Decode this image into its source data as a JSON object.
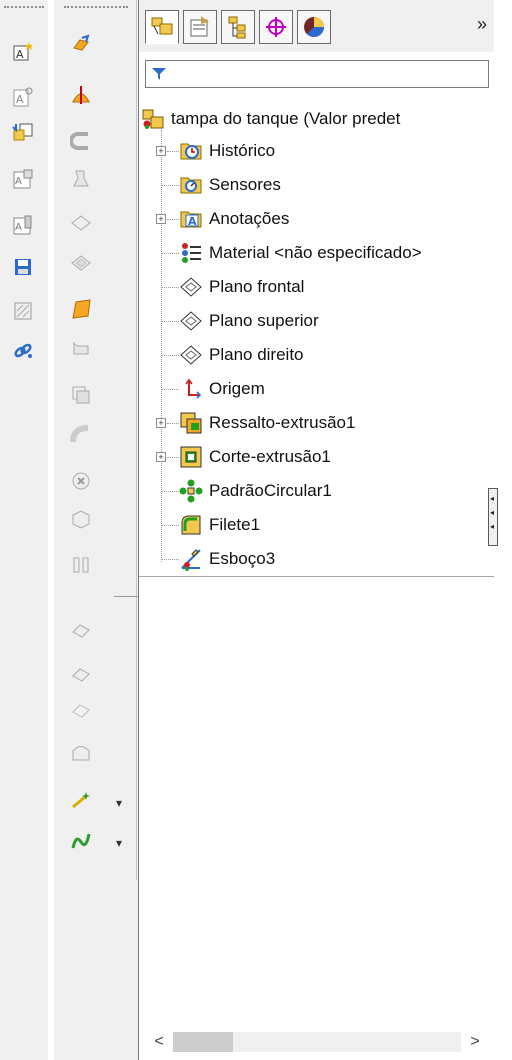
{
  "toolbar_left": {
    "icons": [
      "note-icon",
      "balloon-icon",
      "import-icon",
      "table-icon",
      "block-icon",
      "save-icon",
      "hatch-icon",
      "link-icon"
    ]
  },
  "toolbar_features": {
    "icons": [
      "extrude-boss-icon",
      "revolve-icon",
      "swept-icon",
      "loft-icon",
      "plane-icon",
      "reference-plane-icon",
      "folder-icon",
      "fillet-icon",
      "shell-icon",
      "pipe-icon",
      "cut-icon",
      "rib-icon",
      "mirror-icon",
      "curve-1-icon",
      "curve-2-icon",
      "curve-3-icon",
      "dome-icon",
      "sketch-tool-icon",
      "spline-icon"
    ]
  },
  "tabs": [
    {
      "name": "feature-manager-tab",
      "active": true
    },
    {
      "name": "property-manager-tab",
      "active": false
    },
    {
      "name": "configuration-manager-tab",
      "active": false
    },
    {
      "name": "dimxpert-tab",
      "active": false
    },
    {
      "name": "display-manager-tab",
      "active": false
    }
  ],
  "more_tabs": "»",
  "tree": {
    "root": "tampa do tanque  (Valor predet",
    "items": [
      {
        "label": "Histórico",
        "expandable": true
      },
      {
        "label": "Sensores",
        "expandable": false
      },
      {
        "label": "Anotações",
        "expandable": true
      },
      {
        "label": "Material <não especificado>",
        "expandable": false
      },
      {
        "label": "Plano frontal",
        "expandable": false
      },
      {
        "label": "Plano superior",
        "expandable": false
      },
      {
        "label": "Plano direito",
        "expandable": false
      },
      {
        "label": "Origem",
        "expandable": false
      },
      {
        "label": "Ressalto-extrusão1",
        "expandable": true
      },
      {
        "label": "Corte-extrusão1",
        "expandable": true
      },
      {
        "label": "PadrãoCircular1",
        "expandable": false
      },
      {
        "label": "Filete1",
        "expandable": false
      },
      {
        "label": "Esboço3",
        "expandable": false
      }
    ]
  },
  "scrollbar": {
    "left": "<",
    "right": ">"
  },
  "colors": {
    "accent": "#2a6bd0",
    "folder": "#f2c94c",
    "tab_border": "#6b6b6b"
  }
}
